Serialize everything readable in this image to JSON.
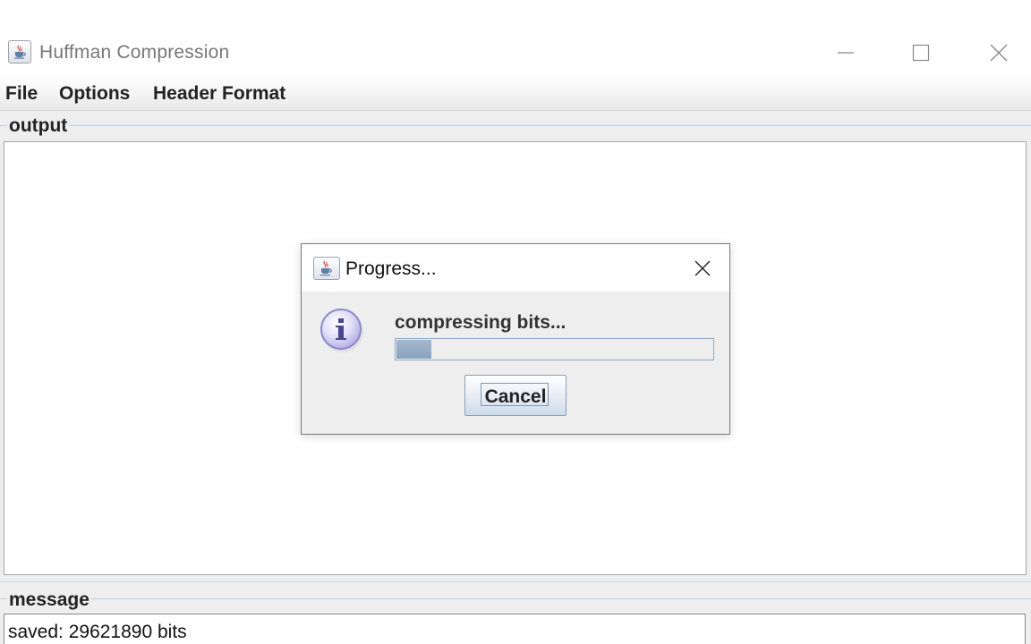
{
  "window": {
    "title": "Huffman Compression",
    "icon": "java-cup-icon",
    "controls": [
      "minimize-icon",
      "maximize-icon",
      "close-icon"
    ]
  },
  "menubar": {
    "items": [
      {
        "label": "File"
      },
      {
        "label": "Options"
      },
      {
        "label": "Header Format"
      }
    ]
  },
  "output_panel": {
    "label": "output",
    "content": ""
  },
  "message_panel": {
    "label": "message",
    "text": "saved: 29621890 bits"
  },
  "dialog": {
    "title": "Progress...",
    "icon": "java-cup-icon",
    "info_icon": "info-icon",
    "message": "compressing bits...",
    "progress_fraction": 0.11,
    "cancel_label": "Cancel"
  },
  "colors": {
    "progress_fill": "#8fa7c1",
    "panel_background": "#eeeeee",
    "group_border": "#b8cfe5"
  }
}
